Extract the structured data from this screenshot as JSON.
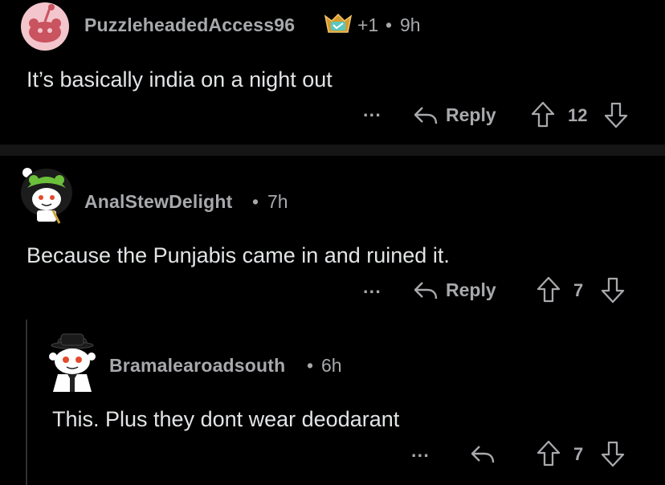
{
  "comments": [
    {
      "author": "PuzzleheadedAccess96",
      "score_badge": "+1",
      "separator": "•",
      "time": "9h",
      "text": "It’s basically india on a night out",
      "more_label": "···",
      "reply_label": "Reply",
      "votes": "12"
    },
    {
      "author": "AnalStewDelight",
      "separator": "•",
      "time": "7h",
      "text": "Because the Punjabis came in and ruined it.",
      "more_label": "···",
      "reply_label": "Reply",
      "votes": "7"
    },
    {
      "author": "Bramalearoadsouth",
      "separator": "•",
      "time": "6h",
      "text": "This. Plus they dont wear deodarant",
      "more_label": "···",
      "votes": "7"
    }
  ],
  "icons": {
    "avatar_1": "avatar",
    "award": "award-badge-icon",
    "avatar_2": "avatar",
    "avatar_3": "avatar",
    "reply": "reply-arrow-icon",
    "upvote": "upvote-arrow-icon",
    "downvote": "downvote-arrow-icon"
  },
  "colors": {
    "background": "#000000",
    "text": "#e2e4e6",
    "meta": "#a7a9ac",
    "divider": "#151515",
    "thread_line": "#2f3033"
  }
}
